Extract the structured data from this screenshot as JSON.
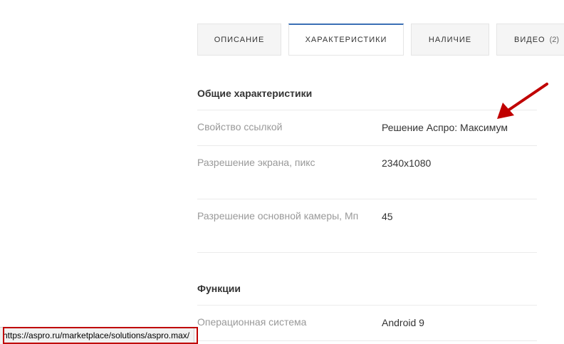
{
  "tabs": [
    {
      "label": "Описание",
      "active": false
    },
    {
      "label": "Характеристики",
      "active": true
    },
    {
      "label": "Наличие",
      "active": false
    },
    {
      "label": "Видео",
      "count": "(2)",
      "active": false
    }
  ],
  "groups": [
    {
      "title": "Общие характеристики",
      "rows": [
        {
          "name": "Свойство ссылкой",
          "value": "Решение Аспро: Максимум"
        },
        {
          "name": "Разрешение экрана, пикс",
          "value": "2340x1080"
        },
        {
          "name": "Разрешение основной камеры, Мп",
          "value": "45"
        }
      ]
    },
    {
      "title": "Функции",
      "rows": [
        {
          "name": "Операционная система",
          "value": "Android 9"
        }
      ]
    }
  ],
  "status_bar": {
    "url": "https://aspro.ru/marketplace/solutions/aspro.max/"
  },
  "colors": {
    "accent": "#3a6fb5",
    "annotation": "#c00000"
  }
}
